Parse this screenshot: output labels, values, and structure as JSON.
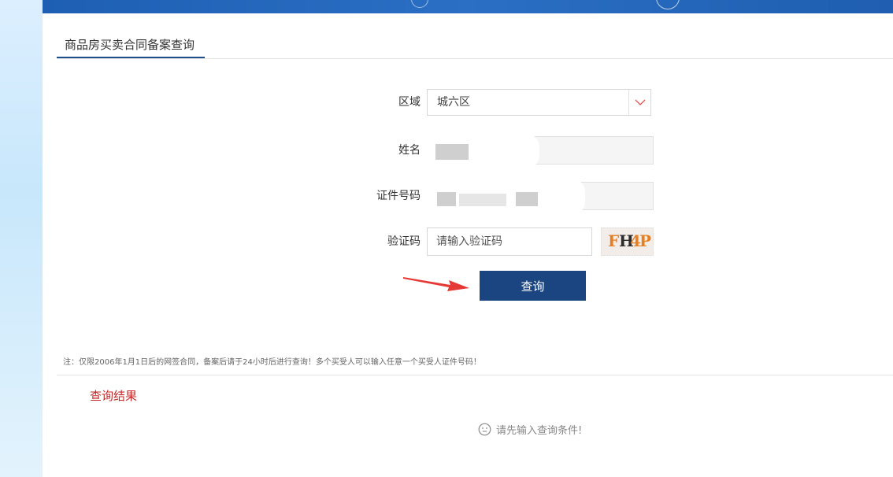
{
  "tab": {
    "active_label": "商品房买卖合同备案查询"
  },
  "form": {
    "region_label": "区域",
    "region_value": "城六区",
    "name_label": "姓名",
    "id_label": "证件号码",
    "captcha_label": "验证码",
    "captcha_placeholder": "请输入验证码",
    "captcha_chars": [
      "F",
      "H",
      "4",
      "P"
    ],
    "submit_label": "查询"
  },
  "note": "注：仅限2006年1月1日后的网签合同，备案后请于24小时后进行查询！多个买受人可以输入任意一个买受人证件号码！",
  "results": {
    "title": "查询结果",
    "empty_message": "请先输入查询条件!"
  },
  "icons": {
    "dropdown": "chevron-down-icon",
    "empty": "smiley-icon",
    "pointer": "red-arrow-icon"
  },
  "colors": {
    "primary": "#1b4581",
    "header": "#1e5fb3",
    "accent_red": "#c62828",
    "arrow_red": "#e53935"
  }
}
